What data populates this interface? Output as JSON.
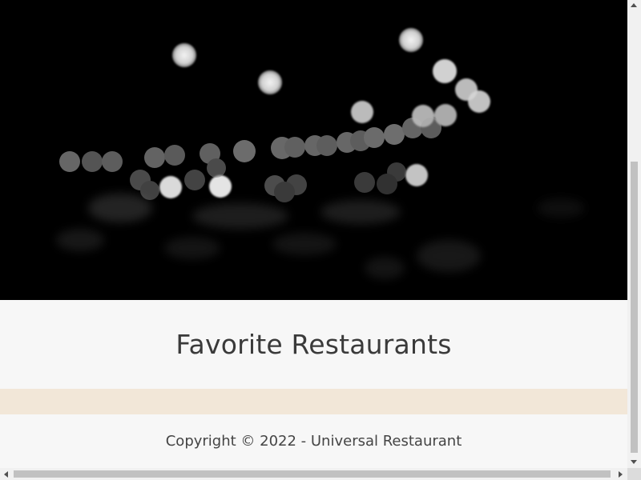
{
  "hero": {
    "image_name": "bokeh-lights-hero-image"
  },
  "main": {
    "title": "Favorite Restaurants"
  },
  "footer": {
    "copyright": "Copyright © 2022 - Universal Restaurant"
  },
  "colors": {
    "hero_background": "#000000",
    "page_background": "#f7f7f7",
    "content_strip": "#f2e7d8",
    "title_text": "#3a3a3a",
    "footer_text": "#444444"
  },
  "scroll": {
    "vertical_position": 0.6,
    "horizontal_position": 0.0
  }
}
